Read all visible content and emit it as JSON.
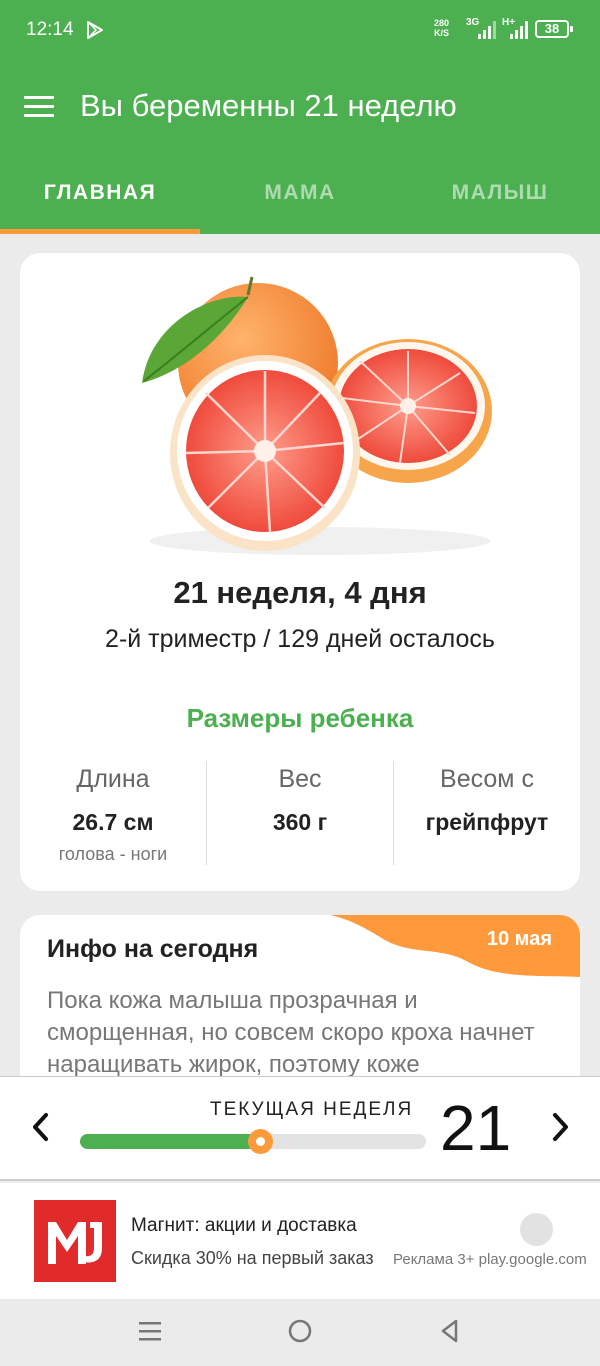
{
  "status_bar": {
    "time": "12:14",
    "net_speed_value": "280",
    "net_speed_unit": "K/S",
    "signal1": "3G",
    "signal2": "H+",
    "battery": "38"
  },
  "app_bar": {
    "title": "Вы беременны 21 неделю"
  },
  "tabs": [
    {
      "label": "ГЛАВНАЯ",
      "active": true
    },
    {
      "label": "МАМА",
      "active": false
    },
    {
      "label": "МАЛЫШ",
      "active": false
    }
  ],
  "summary_card": {
    "week_text": "21 неделя, 4 дня",
    "trimester_text": "2-й триместр / 129 дней осталось",
    "sizes_title": "Размеры ребенка",
    "columns": [
      {
        "label": "Длина",
        "value": "26.7 см",
        "sub": "голова - ноги"
      },
      {
        "label": "Вес",
        "value": "360 г",
        "sub": ""
      },
      {
        "label": "Весом с",
        "value": "грейпфрут",
        "sub": ""
      }
    ]
  },
  "info_card": {
    "title": "Инфо на сегодня",
    "date": "10 мая",
    "body": "Пока кожа малыша прозрачная и сморщенная, но совсем скоро кроха начнет наращивать жирок, поэтому коже"
  },
  "week_selector": {
    "label": "ТЕКУЩАЯ НЕДЕЛЯ",
    "current_week": "21",
    "progress_fraction": 0.52
  },
  "ad": {
    "title": "Магнит: акции и доставка",
    "subtitle": "Скидка 30% на первый заказ",
    "meta": "Реклама 3+ play.google.com"
  },
  "colors": {
    "primary": "#4caf50",
    "accent": "#ff9a3c",
    "ad_brand": "#e12a2a"
  }
}
